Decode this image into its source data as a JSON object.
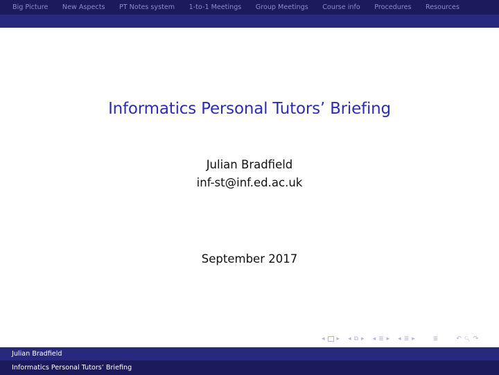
{
  "nav": {
    "items": [
      {
        "label": "Big Picture"
      },
      {
        "label": "New Aspects"
      },
      {
        "label": "PT Notes system"
      },
      {
        "label": "1-to-1 Meetings"
      },
      {
        "label": "Group Meetings"
      },
      {
        "label": "Course info"
      },
      {
        "label": "Procedures"
      },
      {
        "label": "Resources"
      }
    ]
  },
  "slide": {
    "title": "Informatics Personal Tutors’ Briefing",
    "author": "Julian Bradfield",
    "email": "inf-st@inf.ed.ac.uk",
    "date": "September 2017"
  },
  "nav_symbols": {
    "left_arrow": "◂",
    "right_arrow": "▸",
    "frame_icon": "□",
    "subsection_icon": "⧉",
    "section_icon": "≣",
    "document_icon": "≣",
    "back_icon": "↶",
    "search_icon": "🔍︎",
    "forward_icon": "↷"
  },
  "footer": {
    "author": "Julian Bradfield",
    "title": "Informatics Personal Tutors’ Briefing"
  },
  "colors": {
    "nav_dark": "#1b1a5c",
    "nav_light": "#27297f",
    "title": "#2d2db4",
    "nav_text": "#8c8cc8"
  }
}
